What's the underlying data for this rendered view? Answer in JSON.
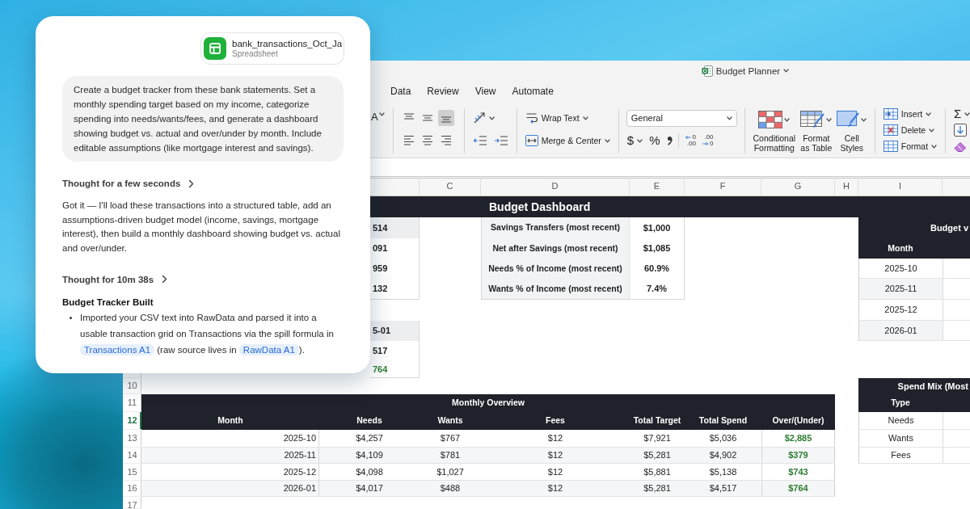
{
  "chat": {
    "attachment": {
      "file_name": "bank_transactions_Oct_Ja",
      "file_type": "Spreadsheet"
    },
    "prompt": "Create a budget tracker from these bank statements. Set a monthly spending target based on my income, categorize spending into needs/wants/fees, and generate a dashboard showing budget vs. actual and over/under by month. Include editable assumptions (like mortgage interest and savings).",
    "blocks": [
      {
        "kind": "thought",
        "text": "Thought for a few seconds"
      },
      {
        "kind": "paragraph",
        "text": "Got it — I'll load these transactions into a structured table, add an assumptions-driven budget model (income, savings, mortgage interest), then build a monthly dashboard showing budget vs. actual and over/under."
      },
      {
        "kind": "thought",
        "text": "Thought for 10m 38s"
      },
      {
        "kind": "heading",
        "text": "Budget Tracker Built"
      },
      {
        "kind": "bullet",
        "parts": [
          {
            "kind": "text",
            "text": "Imported your CSV text into RawData and parsed it into a usable transaction grid on Transactions via the spill formula in "
          },
          {
            "kind": "link",
            "text": "Transactions A1"
          },
          {
            "kind": "text",
            "text": " (raw source lives in "
          },
          {
            "kind": "link",
            "text": "RawData A1"
          },
          {
            "kind": "text",
            "text": ")."
          }
        ]
      }
    ]
  },
  "spreadsheet": {
    "title": "Budget Planner",
    "tabs": [
      {
        "label": "Data",
        "selected": false
      },
      {
        "label": "Review",
        "selected": false
      },
      {
        "label": "View",
        "selected": false
      },
      {
        "label": "Automate",
        "selected": false
      }
    ],
    "ribbon": {
      "font_size_label": "A",
      "vertical_align": [
        {
          "kind": "top",
          "selected": false
        },
        {
          "kind": "middle",
          "selected": false
        },
        {
          "kind": "bottom",
          "selected": true
        }
      ],
      "horizontal_align": [
        {
          "kind": "left",
          "selected": false
        },
        {
          "kind": "center",
          "selected": false
        },
        {
          "kind": "right",
          "selected": false
        }
      ],
      "wrap_text": "Wrap Text",
      "merge": "Merge & Center",
      "number_format": "General",
      "currency": "$",
      "percent": "%",
      "decimals": [
        {
          "kind": "increase",
          "lines": [
            "0",
            ".00"
          ]
        },
        {
          "kind": "decrease",
          "lines": [
            ".00",
            "0"
          ]
        }
      ],
      "styles": [
        {
          "kind": "conditional",
          "label": "Conditional Formatting"
        },
        {
          "kind": "table",
          "label": "Format as Table"
        },
        {
          "kind": "cell",
          "label": "Cell Styles"
        }
      ],
      "cells": [
        {
          "kind": "insert",
          "label": "Insert"
        },
        {
          "kind": "delete",
          "label": "Delete"
        },
        {
          "kind": "format",
          "label": "Format"
        }
      ],
      "autosum": "Σ"
    },
    "column_headers": [
      "C",
      "D",
      "E",
      "F",
      "G",
      "H",
      "I"
    ],
    "row_headers": [
      {
        "label": "10",
        "selected": false
      },
      {
        "label": "11",
        "selected": false
      },
      {
        "label": "12",
        "selected": true
      },
      {
        "label": "13",
        "selected": false
      },
      {
        "label": "14",
        "selected": false
      },
      {
        "label": "15",
        "selected": false
      },
      {
        "label": "16",
        "selected": false
      },
      {
        "label": "17",
        "selected": false
      }
    ],
    "dashboard_title": "Budget Dashboard",
    "partial_columns": [
      {
        "cells": [
          {
            "kind": "header",
            "text": "514"
          },
          {
            "kind": "value",
            "text": "091"
          },
          {
            "kind": "value",
            "text": "959"
          },
          {
            "kind": "value",
            "text": "132"
          }
        ]
      },
      {
        "cells": [
          {
            "kind": "header",
            "text": "5-01"
          },
          {
            "kind": "value",
            "text": "517"
          },
          {
            "kind": "positive",
            "text": "764"
          }
        ]
      }
    ],
    "key_metrics": [
      {
        "label": "Savings Transfers (most recent)",
        "value": "$1,000"
      },
      {
        "label": "Net after Savings (most recent)",
        "value": "$1,085"
      },
      {
        "label": "Needs % of Income (most recent)",
        "value": "60.9%"
      },
      {
        "label": "Wants % of Income (most recent)",
        "value": "7.4%"
      }
    ],
    "budget_vs_actual": {
      "title": "Budget v",
      "header": "Month",
      "rows": [
        "2025-10",
        "2025-11",
        "2025-12",
        "2026-01"
      ]
    },
    "monthly_overview": {
      "title": "Monthly Overview",
      "columns": [
        "Month",
        "Needs",
        "Wants",
        "Fees",
        "Total Target",
        "Total Spend",
        "Over/(Under)"
      ],
      "rows": [
        [
          "2025-10",
          "$4,257",
          "$767",
          "$12",
          "$7,921",
          "$5,036",
          "$2,885"
        ],
        [
          "2025-11",
          "$4,109",
          "$781",
          "$12",
          "$5,281",
          "$4,902",
          "$379"
        ],
        [
          "2025-12",
          "$4,098",
          "$1,027",
          "$12",
          "$5,881",
          "$5,138",
          "$743"
        ],
        [
          "2026-01",
          "$4,017",
          "$488",
          "$12",
          "$5,281",
          "$4,517",
          "$764"
        ]
      ]
    },
    "spend_mix": {
      "title": "Spend Mix (Most",
      "header": "Type",
      "rows": [
        "Needs",
        "Wants",
        "Fees"
      ]
    }
  }
}
